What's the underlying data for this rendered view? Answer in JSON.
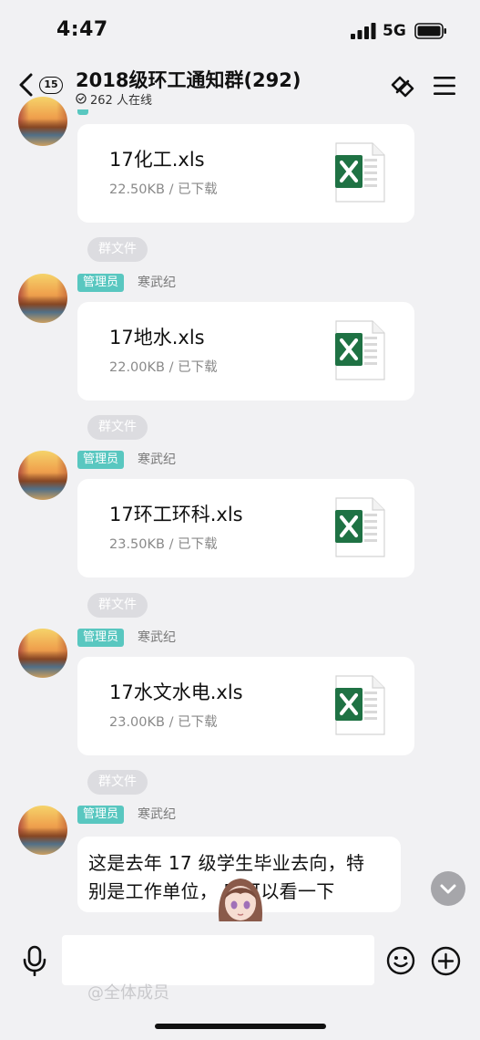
{
  "status_bar": {
    "time": "4:47",
    "network": "5G"
  },
  "header": {
    "unread_count": "15",
    "title": "2018级环工通知群(292)",
    "online_text": "262 人在线"
  },
  "messages": [
    {
      "kind": "file",
      "file_name": "17化工.xls",
      "file_meta": "22.50KB / 已下载",
      "icon": "excel-file-icon"
    },
    {
      "kind": "system",
      "text": "群文件"
    },
    {
      "kind": "file",
      "role_badge": "管理员",
      "sender": "寒武纪",
      "file_name": "17地水.xls",
      "file_meta": "22.00KB / 已下载",
      "icon": "excel-file-icon"
    },
    {
      "kind": "system",
      "text": "群文件"
    },
    {
      "kind": "file",
      "role_badge": "管理员",
      "sender": "寒武纪",
      "file_name": "17环工环科.xls",
      "file_meta": "23.50KB / 已下载",
      "icon": "excel-file-icon"
    },
    {
      "kind": "system",
      "text": "群文件"
    },
    {
      "kind": "file",
      "role_badge": "管理员",
      "sender": "寒武纪",
      "file_name": "17水文水电.xls",
      "file_meta": "23.00KB / 已下载",
      "icon": "excel-file-icon"
    },
    {
      "kind": "system",
      "text": "群文件"
    },
    {
      "kind": "text",
      "role_badge": "管理员",
      "sender": "寒武纪",
      "lines": [
        "这是去年 17 级学生毕业去向，特",
        "别是工作单位，   家可以看一下"
      ]
    }
  ],
  "input_bar": {
    "ghost_text": "@全体成员"
  },
  "colors": {
    "background": "#f1f1f3",
    "admin_badge": "#59c7c0",
    "excel_green": "#1f7244",
    "system_pill": "#dcdce0"
  }
}
